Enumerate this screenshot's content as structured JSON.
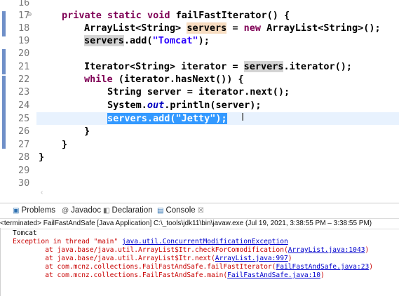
{
  "editor": {
    "line_numbers": [
      "16",
      "17",
      "18",
      "19",
      "20",
      "21",
      "22",
      "23",
      "24",
      "25",
      "26",
      "27",
      "28",
      "29",
      "30"
    ],
    "line17": {
      "kw1": "private",
      "kw2": "static",
      "kw3": "void",
      "rest": " failFastIterator() {"
    },
    "line18": {
      "pre": "ArrayList<String> ",
      "var": "servers",
      "mid": " = ",
      "kw": "new",
      "post": " ArrayList<String>();"
    },
    "line19": {
      "var": "servers",
      "mid": ".add(",
      "str": "\"Tomcat\"",
      "post": ");"
    },
    "line21": {
      "pre": "Iterator<String> iterator = ",
      "var": "servers",
      "post": ".iterator();"
    },
    "line22": {
      "kw": "while",
      "post": " (iterator.hasNext()) {"
    },
    "line23": {
      "text": "String server = iterator.next();"
    },
    "line24": {
      "pre": "System.",
      "fld": "out",
      "post": ".println(server);"
    },
    "line25": {
      "selected": "servers.add(\"Jetty\");"
    },
    "line26": {
      "text": "}"
    },
    "line27": {
      "text": "}"
    },
    "line28": {
      "text": "}"
    }
  },
  "console": {
    "tabs": [
      {
        "label": "Problems",
        "icon": "problems-icon"
      },
      {
        "label": "Javadoc",
        "icon": "javadoc-icon"
      },
      {
        "label": "Declaration",
        "icon": "declaration-icon"
      },
      {
        "label": "Console",
        "icon": "console-icon",
        "close": "☒"
      }
    ],
    "status": "<terminated> FailFastAndSafe [Java Application] C:\\_tools\\jdk11\\bin\\javaw.exe  (Jul 19, 2021, 3:38:55 PM – 3:38:55 PM)",
    "output": {
      "line1": "Tomcat",
      "line2_pre": "Exception in thread \"main\" ",
      "line2_link": "java.util.ConcurrentModificationException",
      "trace": [
        {
          "pre": "        at java.base/java.util.ArrayList$Itr.checkForComodification(",
          "link": "ArrayList.java:1043",
          "post": ")"
        },
        {
          "pre": "        at java.base/java.util.ArrayList$Itr.next(",
          "link": "ArrayList.java:997",
          "post": ")"
        },
        {
          "pre": "        at com.mcnz.collections.FailFastAndSafe.failFastIterator(",
          "link": "FailFastAndSafe.java:23",
          "post": ")"
        },
        {
          "pre": "        at com.mcnz.collections.FailFastAndSafe.main(",
          "link": "FailFastAndSafe.java:10",
          "post": ")"
        }
      ]
    }
  },
  "colors": {
    "keyword": "#7f0055",
    "string": "#2a00ff",
    "error": "#c80000",
    "link": "#0000cc",
    "selection": "#3399ff",
    "current_line": "#e8f2fe"
  }
}
